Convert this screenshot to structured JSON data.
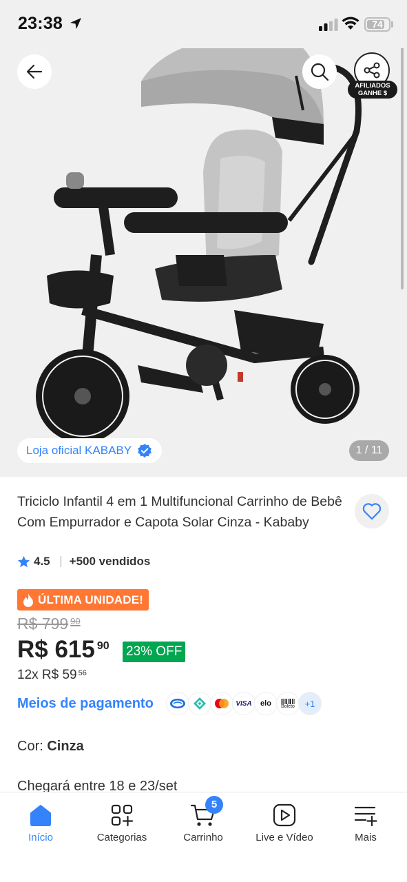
{
  "status_bar": {
    "time": "23:38",
    "battery": "74"
  },
  "gallery": {
    "image_counter": "1 / 11",
    "store_label": "Loja oficial KABABY",
    "affiliate_line1": "AFILIADOS",
    "affiliate_line2": "GANHE $"
  },
  "product": {
    "title": "Triciclo Infantil 4 em 1 Multifuncional Carrinho de Bebê Com Empurrador e Capota Solar Cinza - Kababy",
    "rating": "4.5",
    "sold": "+500 vendidos",
    "badge": "ÚLTIMA UNIDADE!",
    "old_price_int": "R$ 799",
    "old_price_cents": "90",
    "price_int": "R$ 615",
    "price_cents": "90",
    "discount": "23% OFF",
    "installments_int": "12x R$ 59",
    "installments_cents": "56",
    "payment_link": "Meios de pagamento",
    "payment_more": "+1",
    "payment_visa": "VISA",
    "payment_elo": "elo",
    "payment_boleto": "Boleto",
    "color_label": "Cor:",
    "color_value": "Cinza",
    "arrival": "Chegará entre 18 e 23/set"
  },
  "tabbar": {
    "tabs": [
      {
        "label": "Início"
      },
      {
        "label": "Categorias"
      },
      {
        "label": "Carrinho",
        "badge": "5"
      },
      {
        "label": "Live e Vídeo"
      },
      {
        "label": "Mais"
      }
    ]
  },
  "colors": {
    "accent": "#3483fa",
    "orange": "#ff7733",
    "green": "#00a650"
  }
}
